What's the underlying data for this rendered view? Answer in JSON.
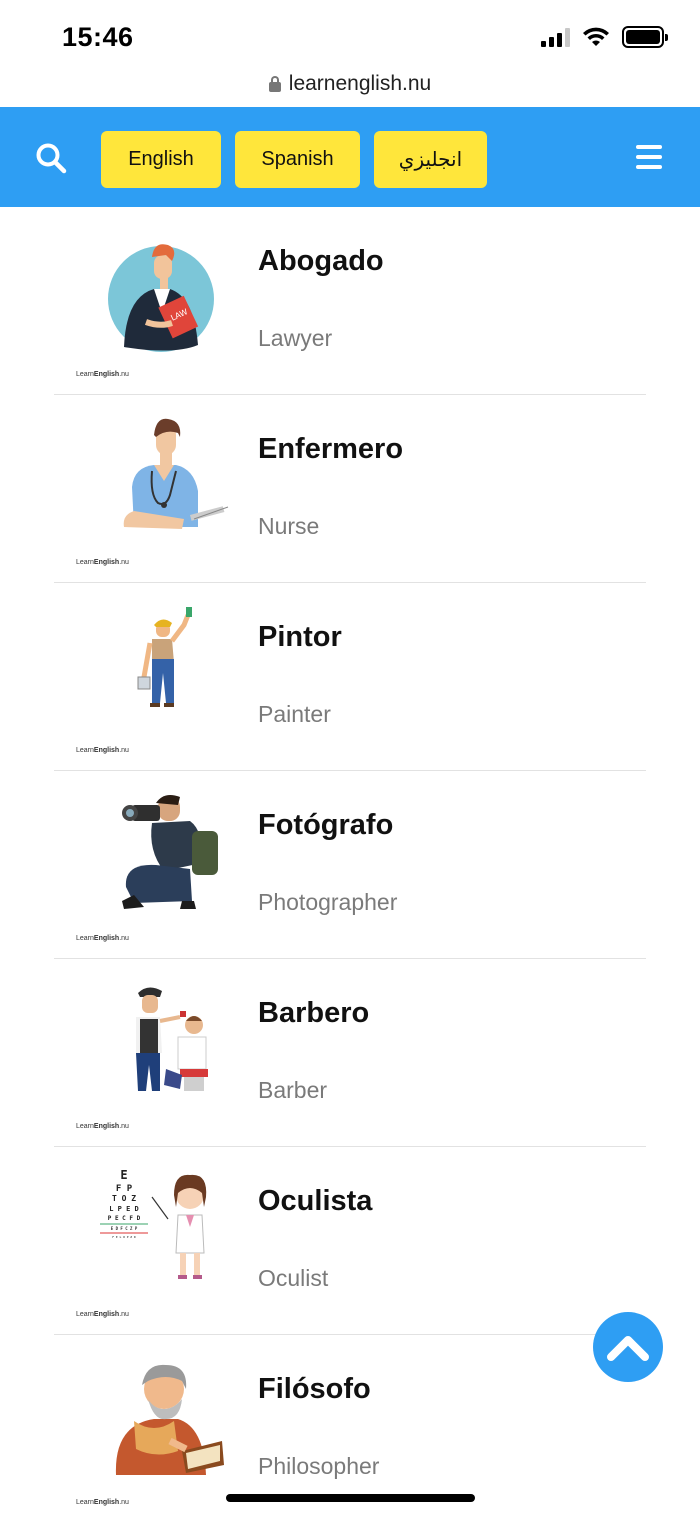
{
  "status": {
    "time": "15:46"
  },
  "browser": {
    "url": "learnenglish.nu"
  },
  "header": {
    "search_icon": "search-icon",
    "menu_icon": "hamburger-menu-icon",
    "languages": [
      {
        "label": "English"
      },
      {
        "label": "Spanish"
      },
      {
        "label": "انجليزي"
      }
    ]
  },
  "watermark": {
    "prefix": "Learn",
    "bold": "English",
    "suffix": ".nu"
  },
  "items": [
    {
      "title": "Abogado",
      "subtitle": "Lawyer",
      "icon": "lawyer-illustration"
    },
    {
      "title": "Enfermero",
      "subtitle": "Nurse",
      "icon": "nurse-illustration"
    },
    {
      "title": "Pintor",
      "subtitle": "Painter",
      "icon": "painter-illustration"
    },
    {
      "title": "Fotógrafo",
      "subtitle": "Photographer",
      "icon": "photographer-illustration"
    },
    {
      "title": "Barbero",
      "subtitle": "Barber",
      "icon": "barber-illustration"
    },
    {
      "title": "Oculista",
      "subtitle": "Oculist",
      "icon": "oculist-illustration"
    },
    {
      "title": "Filósofo",
      "subtitle": "Philosopher",
      "icon": "philosopher-illustration"
    }
  ],
  "eye_chart": {
    "rows": [
      "E",
      "F P",
      "T O Z",
      "L P E D",
      "P E C F D",
      "E D F C Z P",
      "F E L O P Z D"
    ]
  },
  "colors": {
    "brand_blue": "#2e9ef3",
    "button_yellow": "#ffe63b",
    "subtitle_gray": "#7a7a7a"
  }
}
